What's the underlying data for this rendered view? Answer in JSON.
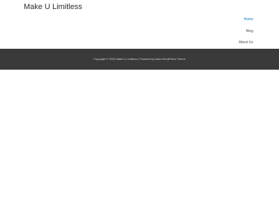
{
  "site": {
    "title": "Make U Limitless"
  },
  "nav": {
    "items": [
      {
        "label": "Home",
        "active": true
      },
      {
        "label": "Blog",
        "active": false
      },
      {
        "label": "About Us",
        "active": false
      }
    ]
  },
  "footer": {
    "copyright": "Copyright © 2020 Make U Limitless | Powered by Astra WordPress Theme"
  },
  "colors": {
    "footer_bg": "#3a3a3a",
    "active_link": "#0274be",
    "text": "#2b2b2b"
  }
}
